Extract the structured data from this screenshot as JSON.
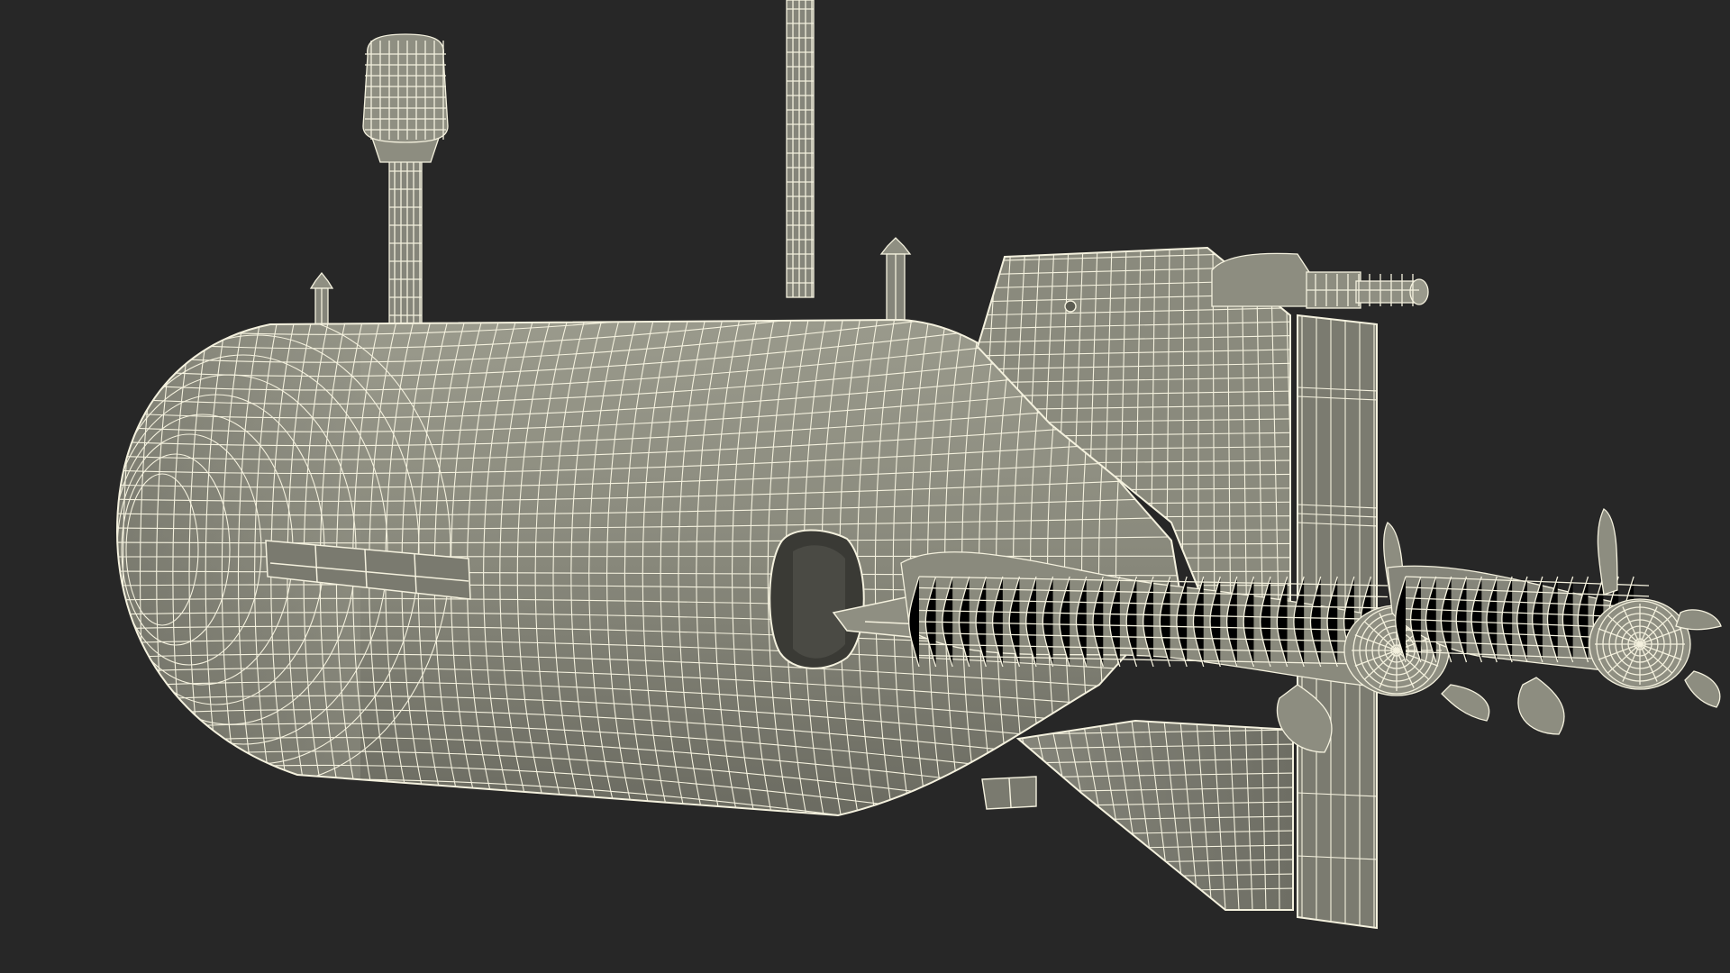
{
  "scene": {
    "subject": "wireframe-submarine-render",
    "colors": {
      "background": "#272727",
      "surface": "#87877a",
      "surface_light": "#a3a394",
      "surface_dark": "#5d5d53",
      "wire": "#f4f1de",
      "hole": "#3a3a35"
    }
  }
}
